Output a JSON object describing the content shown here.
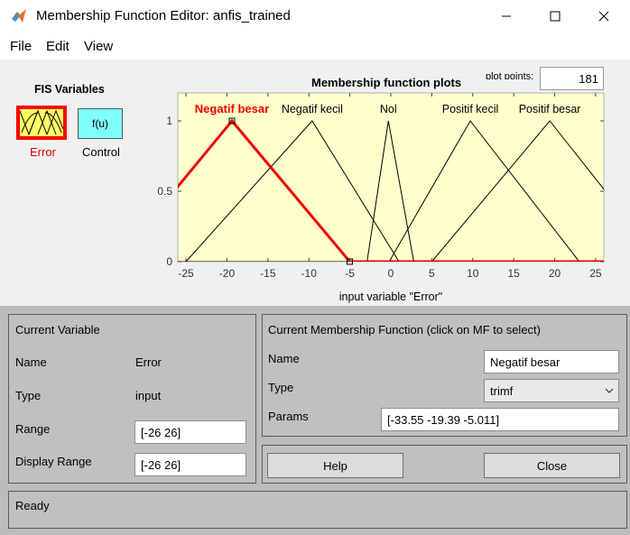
{
  "window": {
    "title": "Membership Function Editor: anfis_trained"
  },
  "menu": {
    "file": "File",
    "edit": "Edit",
    "view": "View"
  },
  "fis_variables": {
    "heading": "FIS Variables",
    "control_box_label": "f(u)",
    "input_label": "Error",
    "output_label": "Control"
  },
  "plot": {
    "title": "Membership function plots",
    "plot_points_label": "plot points:",
    "plot_points_value": "181",
    "xlabel": "input variable \"Error\""
  },
  "chart_data": {
    "type": "line",
    "xlabel": "input variable \"Error\"",
    "title": "Membership function plots",
    "xlim": [
      -26,
      26
    ],
    "ylim": [
      0,
      1.0
    ],
    "xticks": [
      -25,
      -20,
      -15,
      -10,
      -5,
      0,
      5,
      10,
      15,
      20,
      25
    ],
    "xtick_labels": [
      "-25",
      "-20",
      "-15",
      "-10",
      "-5",
      "0",
      "5",
      "10",
      "15",
      "20",
      "25"
    ],
    "yticks": [
      0,
      0.5,
      1
    ],
    "ytick_labels": [
      "0",
      "0.5",
      "1"
    ],
    "series": [
      {
        "name": "Negatif besar",
        "params": [
          -33.55,
          -19.39,
          -5.011
        ],
        "selected": true
      },
      {
        "name": "Negatif kecil",
        "params": [
          -25,
          -9.6,
          1
        ],
        "selected": false
      },
      {
        "name": "Nol",
        "params": [
          -2.9,
          -0.3,
          2.8
        ],
        "selected": false
      },
      {
        "name": "Positif kecil",
        "params": [
          -0.2,
          9.7,
          23
        ],
        "selected": false
      },
      {
        "name": "Positif besar",
        "params": [
          5,
          19.4,
          33
        ],
        "selected": false
      }
    ],
    "colors": {
      "background": "#ffffcc",
      "selected": "#ee0000",
      "normal": "#000000"
    }
  },
  "current_variable": {
    "heading": "Current Variable",
    "name_label": "Name",
    "name_value": "Error",
    "type_label": "Type",
    "type_value": "input",
    "range_label": "Range",
    "range_value": "[-26 26]",
    "display_range_label": "Display Range",
    "display_range_value": "[-26 26]"
  },
  "current_mf": {
    "heading": "Current Membership Function (click on MF to select)",
    "name_label": "Name",
    "name_value": "Negatif besar",
    "type_label": "Type",
    "type_value": "trimf",
    "params_label": "Params",
    "params_value": "[-33.55 -19.39 -5.011]"
  },
  "buttons": {
    "help": "Help",
    "close": "Close"
  },
  "status": {
    "text": "Ready"
  }
}
